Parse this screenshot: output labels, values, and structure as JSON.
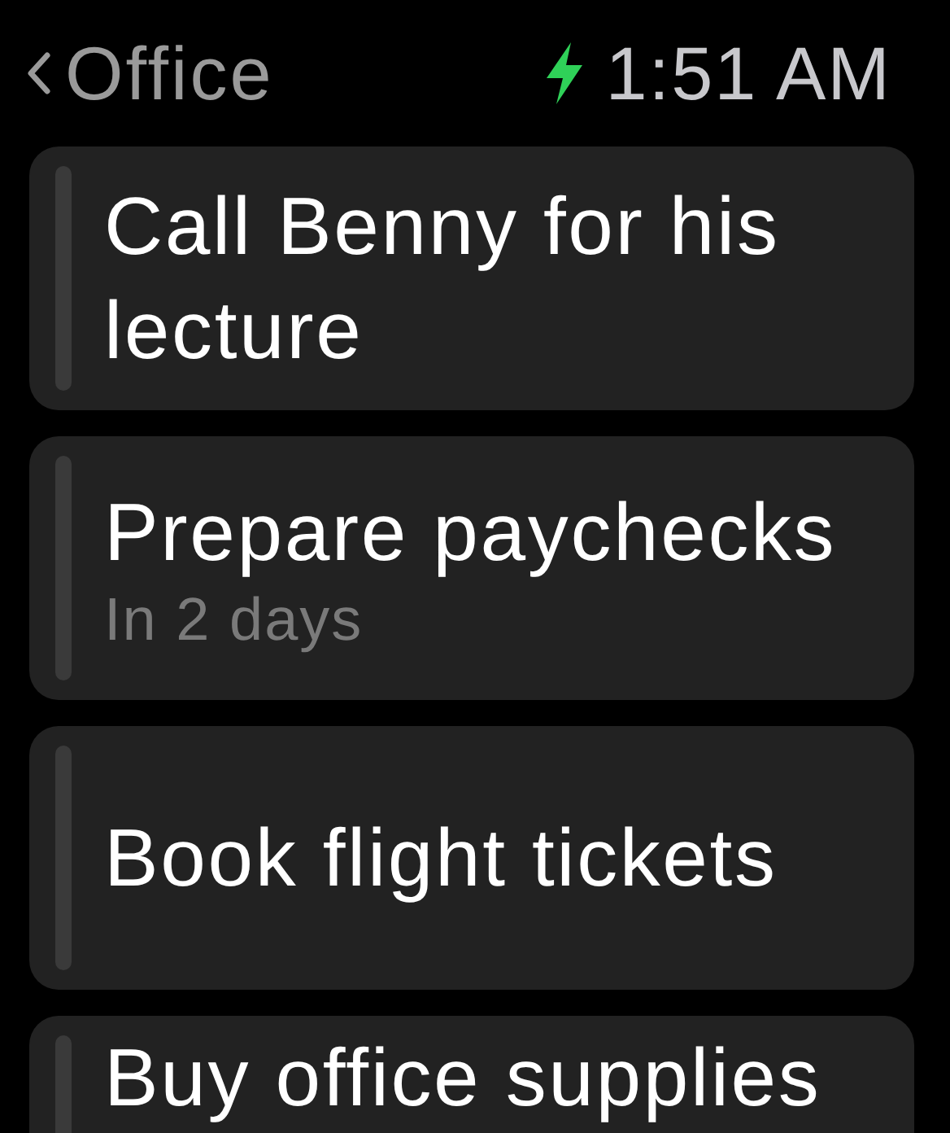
{
  "header": {
    "back_label": "Office",
    "time": "1:51 AM",
    "charging": true
  },
  "tasks": [
    {
      "title": "Call Benny for his lecture"
    },
    {
      "title": "Prepare paychecks",
      "subtitle": "In 2 days"
    },
    {
      "title": "Book flight tickets"
    },
    {
      "title": "Buy office supplies"
    }
  ]
}
